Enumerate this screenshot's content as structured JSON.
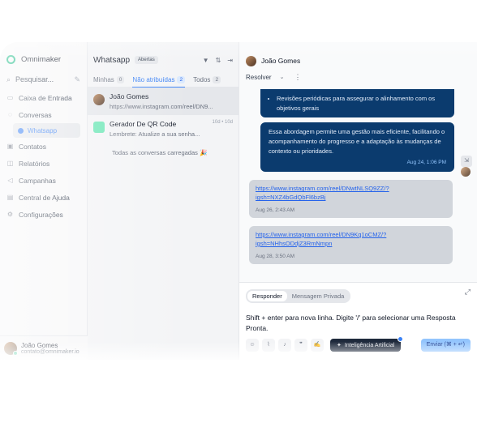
{
  "brand": {
    "name": "Omnimaker"
  },
  "sidebar": {
    "search": "Pesquisar...",
    "items": [
      {
        "label": "Caixa de Entrada",
        "icon": "inbox-icon"
      },
      {
        "label": "Conversas",
        "icon": "chat-icon"
      },
      {
        "label": "Whatsapp",
        "icon": "whatsapp-icon"
      },
      {
        "label": "Contatos",
        "icon": "contacts-icon"
      },
      {
        "label": "Relatórios",
        "icon": "reports-icon"
      },
      {
        "label": "Campanhas",
        "icon": "campaign-icon"
      },
      {
        "label": "Central de Ajuda",
        "icon": "help-icon"
      },
      {
        "label": "Configurações",
        "icon": "gear-icon"
      }
    ],
    "user": {
      "name": "João Gomes",
      "email": "contato@omnimaker.io"
    }
  },
  "list": {
    "title": "Whatsapp",
    "status_badge": "Abertas",
    "tabs": [
      {
        "label": "Minhas",
        "count": "0"
      },
      {
        "label": "Não atribuídas",
        "count": "2"
      },
      {
        "label": "Todos",
        "count": "2"
      }
    ],
    "conversations": [
      {
        "name": "João Gomes",
        "time": "",
        "message": "https://www.instagram.com/reel/DN9..."
      },
      {
        "name": "Gerador De QR Code",
        "time": "10d • 10d",
        "message": "Lembrete: Atualize a sua senha..."
      }
    ],
    "loaded_text": "Todas as conversas carregadas 🎉"
  },
  "chat": {
    "contact_name": "João Gomes",
    "resolve_label": "Resolver",
    "messages": {
      "out_bullet": "Revisões periódicas para assegurar o alinhamento com os objetivos gerais",
      "out_text": "Essa abordagem permite uma gestão mais eficiente, facilitando o acompanhamento do progresso e a adaptação às mudanças de contexto ou prioridades.",
      "out_time": "Aug 24, 1:06 PM",
      "in1_link": "https://www.instagram.com/reel/DNwtNLSQ9ZZ/?igsh=NXZ4bGdQbFl6bzBj",
      "in1_time": "Aug 26, 2:43 AM",
      "in2_link": "https://www.instagram.com/reel/DN9Kq1oCMZ/?igsh=NHhsODdjZ3RmNmpn",
      "in2_time": "Aug 28, 3:50 AM"
    },
    "composer": {
      "tab_reply": "Responder",
      "tab_private": "Mensagem Privada",
      "placeholder": "Shift + enter para nova linha. Digite '/' para selecionar uma Resposta Pronta.",
      "ai_label": "Inteligência Artificial",
      "send_label": "Enviar (⌘ + ↵)"
    }
  }
}
